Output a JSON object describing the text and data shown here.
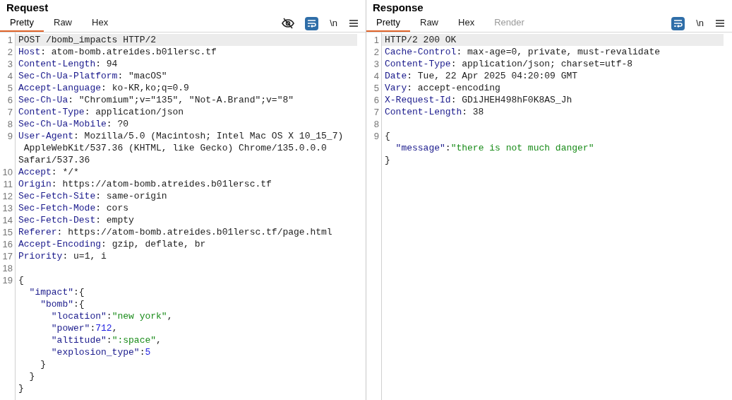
{
  "panes": [
    {
      "title": "Request",
      "tabs": [
        {
          "label": "Pretty",
          "selected": true,
          "disabled": false
        },
        {
          "label": "Raw",
          "selected": false,
          "disabled": false
        },
        {
          "label": "Hex",
          "selected": false,
          "disabled": false
        }
      ],
      "toolbar": [
        {
          "kind": "eye_off",
          "active": false
        },
        {
          "kind": "wrap",
          "active": true
        },
        {
          "kind": "newline",
          "label": "\\n",
          "active": false
        },
        {
          "kind": "menu",
          "active": false
        }
      ],
      "lines": [
        {
          "number": "1",
          "highlighted": true,
          "segments": [
            {
              "kind": "plain",
              "text": "POST /bomb_impacts HTTP/2"
            }
          ]
        },
        {
          "number": "2",
          "highlighted": false,
          "segments": [
            {
              "kind": "name",
              "text": "Host"
            },
            {
              "kind": "plain",
              "text": ": atom-bomb.atreides.b01lersc.tf"
            }
          ]
        },
        {
          "number": "3",
          "highlighted": false,
          "segments": [
            {
              "kind": "name",
              "text": "Content-Length"
            },
            {
              "kind": "plain",
              "text": ": 94"
            }
          ]
        },
        {
          "number": "4",
          "highlighted": false,
          "segments": [
            {
              "kind": "name",
              "text": "Sec-Ch-Ua-Platform"
            },
            {
              "kind": "plain",
              "text": ": \"macOS\""
            }
          ]
        },
        {
          "number": "5",
          "highlighted": false,
          "segments": [
            {
              "kind": "name",
              "text": "Accept-Language"
            },
            {
              "kind": "plain",
              "text": ": ko-KR,ko;q=0.9"
            }
          ]
        },
        {
          "number": "6",
          "highlighted": false,
          "segments": [
            {
              "kind": "name",
              "text": "Sec-Ch-Ua"
            },
            {
              "kind": "plain",
              "text": ": \"Chromium\";v=\"135\", \"Not-A.Brand\";v=\"8\""
            }
          ]
        },
        {
          "number": "7",
          "highlighted": false,
          "segments": [
            {
              "kind": "name",
              "text": "Content-Type"
            },
            {
              "kind": "plain",
              "text": ": application/json"
            }
          ]
        },
        {
          "number": "8",
          "highlighted": false,
          "segments": [
            {
              "kind": "name",
              "text": "Sec-Ch-Ua-Mobile"
            },
            {
              "kind": "plain",
              "text": ": ?0"
            }
          ]
        },
        {
          "number": "9",
          "highlighted": false,
          "segments": [
            {
              "kind": "name",
              "text": "User-Agent"
            },
            {
              "kind": "plain",
              "text": ": Mozilla/5.0 (Macintosh; Intel Mac OS X 10_15_7)"
            }
          ]
        },
        {
          "highlighted": false,
          "segments": [
            {
              "kind": "plain",
              "text": " AppleWebKit/537.36 (KHTML, like Gecko) Chrome/135.0.0.0"
            }
          ]
        },
        {
          "highlighted": false,
          "segments": [
            {
              "kind": "plain",
              "text": "Safari/537.36"
            }
          ]
        },
        {
          "number": "10",
          "highlighted": false,
          "segments": [
            {
              "kind": "name",
              "text": "Accept"
            },
            {
              "kind": "plain",
              "text": ": */*"
            }
          ]
        },
        {
          "number": "11",
          "highlighted": false,
          "segments": [
            {
              "kind": "name",
              "text": "Origin"
            },
            {
              "kind": "plain",
              "text": ": https://atom-bomb.atreides.b01lersc.tf"
            }
          ]
        },
        {
          "number": "12",
          "highlighted": false,
          "segments": [
            {
              "kind": "name",
              "text": "Sec-Fetch-Site"
            },
            {
              "kind": "plain",
              "text": ": same-origin"
            }
          ]
        },
        {
          "number": "13",
          "highlighted": false,
          "segments": [
            {
              "kind": "name",
              "text": "Sec-Fetch-Mode"
            },
            {
              "kind": "plain",
              "text": ": cors"
            }
          ]
        },
        {
          "number": "14",
          "highlighted": false,
          "segments": [
            {
              "kind": "name",
              "text": "Sec-Fetch-Dest"
            },
            {
              "kind": "plain",
              "text": ": empty"
            }
          ]
        },
        {
          "number": "15",
          "highlighted": false,
          "segments": [
            {
              "kind": "name",
              "text": "Referer"
            },
            {
              "kind": "plain",
              "text": ": https://atom-bomb.atreides.b01lersc.tf/page.html"
            }
          ]
        },
        {
          "number": "16",
          "highlighted": false,
          "segments": [
            {
              "kind": "name",
              "text": "Accept-Encoding"
            },
            {
              "kind": "plain",
              "text": ": gzip, deflate, br"
            }
          ]
        },
        {
          "number": "17",
          "highlighted": false,
          "segments": [
            {
              "kind": "name",
              "text": "Priority"
            },
            {
              "kind": "plain",
              "text": ": u=1, i"
            }
          ]
        },
        {
          "number": "18",
          "highlighted": false
        },
        {
          "number": "19",
          "highlighted": false,
          "segments": [
            {
              "kind": "plain",
              "text": "{"
            }
          ]
        },
        {
          "highlighted": false,
          "segments": [
            {
              "kind": "name",
              "text": "  \"impact\""
            },
            {
              "kind": "plain",
              "text": ":{"
            }
          ]
        },
        {
          "highlighted": false,
          "segments": [
            {
              "kind": "name",
              "text": "    \"bomb\""
            },
            {
              "kind": "plain",
              "text": ":{"
            }
          ]
        },
        {
          "highlighted": false,
          "segments": [
            {
              "kind": "name",
              "text": "      \"location\""
            },
            {
              "kind": "plain",
              "text": ":"
            },
            {
              "kind": "string",
              "text": "\"new york\""
            },
            {
              "kind": "plain",
              "text": ","
            }
          ]
        },
        {
          "highlighted": false,
          "segments": [
            {
              "kind": "name",
              "text": "      \"power\""
            },
            {
              "kind": "plain",
              "text": ":"
            },
            {
              "kind": "number",
              "text": "712"
            },
            {
              "kind": "plain",
              "text": ","
            }
          ]
        },
        {
          "highlighted": false,
          "segments": [
            {
              "kind": "name",
              "text": "      \"altitude\""
            },
            {
              "kind": "plain",
              "text": ":"
            },
            {
              "kind": "string",
              "text": "\":space\""
            },
            {
              "kind": "plain",
              "text": ","
            }
          ]
        },
        {
          "highlighted": false,
          "segments": [
            {
              "kind": "name",
              "text": "      \"explosion_type\""
            },
            {
              "kind": "plain",
              "text": ":"
            },
            {
              "kind": "number",
              "text": "5"
            }
          ]
        },
        {
          "highlighted": false,
          "segments": [
            {
              "kind": "plain",
              "text": "    }"
            }
          ]
        },
        {
          "highlighted": false,
          "segments": [
            {
              "kind": "plain",
              "text": "  }"
            }
          ]
        },
        {
          "highlighted": false,
          "segments": [
            {
              "kind": "plain",
              "text": "}"
            }
          ]
        }
      ]
    },
    {
      "title": "Response",
      "tabs": [
        {
          "label": "Pretty",
          "selected": true,
          "disabled": false
        },
        {
          "label": "Raw",
          "selected": false,
          "disabled": false
        },
        {
          "label": "Hex",
          "selected": false,
          "disabled": false
        },
        {
          "label": "Render",
          "selected": false,
          "disabled": true
        }
      ],
      "toolbar": [
        {
          "kind": "wrap",
          "active": true
        },
        {
          "kind": "newline",
          "label": "\\n",
          "active": false
        },
        {
          "kind": "menu",
          "active": false
        }
      ],
      "lines": [
        {
          "number": "1",
          "highlighted": true,
          "segments": [
            {
              "kind": "plain",
              "text": "HTTP/2 200 OK"
            }
          ]
        },
        {
          "number": "2",
          "highlighted": false,
          "segments": [
            {
              "kind": "name",
              "text": "Cache-Control"
            },
            {
              "kind": "plain",
              "text": ": max-age=0, private, must-revalidate"
            }
          ]
        },
        {
          "number": "3",
          "highlighted": false,
          "segments": [
            {
              "kind": "name",
              "text": "Content-Type"
            },
            {
              "kind": "plain",
              "text": ": application/json; charset=utf-8"
            }
          ]
        },
        {
          "number": "4",
          "highlighted": false,
          "segments": [
            {
              "kind": "name",
              "text": "Date"
            },
            {
              "kind": "plain",
              "text": ": Tue, 22 Apr 2025 04:20:09 GMT"
            }
          ]
        },
        {
          "number": "5",
          "highlighted": false,
          "segments": [
            {
              "kind": "name",
              "text": "Vary"
            },
            {
              "kind": "plain",
              "text": ": accept-encoding"
            }
          ]
        },
        {
          "number": "6",
          "highlighted": false,
          "segments": [
            {
              "kind": "name",
              "text": "X-Request-Id"
            },
            {
              "kind": "plain",
              "text": ": GDiJHEH498hF0K8AS_Jh"
            }
          ]
        },
        {
          "number": "7",
          "highlighted": false,
          "segments": [
            {
              "kind": "name",
              "text": "Content-Length"
            },
            {
              "kind": "plain",
              "text": ": 38"
            }
          ]
        },
        {
          "number": "8",
          "highlighted": false
        },
        {
          "number": "9",
          "highlighted": false,
          "segments": [
            {
              "kind": "plain",
              "text": "{"
            }
          ]
        },
        {
          "highlighted": false,
          "segments": [
            {
              "kind": "name",
              "text": "  \"message\""
            },
            {
              "kind": "plain",
              "text": ":"
            },
            {
              "kind": "string",
              "text": "\"there is not much danger\""
            }
          ]
        },
        {
          "highlighted": false,
          "segments": [
            {
              "kind": "plain",
              "text": "}"
            }
          ]
        }
      ]
    }
  ]
}
